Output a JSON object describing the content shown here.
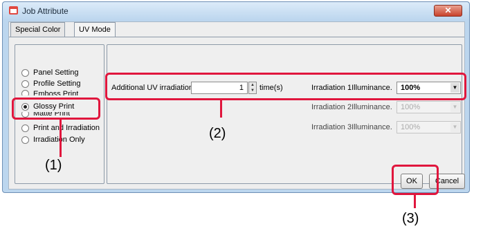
{
  "window": {
    "title": "Job Attribute",
    "close_label": "✕"
  },
  "tabs": [
    {
      "label": "Special Color",
      "active": false
    },
    {
      "label": "UV Mode",
      "active": true
    }
  ],
  "modes": [
    {
      "label": "Panel Setting",
      "checked": false
    },
    {
      "label": "Profile Setting",
      "checked": false
    },
    {
      "label": "Emboss Print",
      "checked": false
    },
    {
      "label": "Glossy Print",
      "checked": true
    },
    {
      "label": "Matte Print",
      "checked": false
    },
    {
      "label": "Print and Irradiation",
      "checked": false
    },
    {
      "label": "Irradiation Only",
      "checked": false
    }
  ],
  "uv": {
    "additional_label": "Additional UV irradiation",
    "additional_value": "1",
    "unit": "time(s)"
  },
  "illuminance": [
    {
      "label": "Irradiation 1Illuminance.",
      "value": "100%",
      "enabled": true
    },
    {
      "label": "Irradiation 2Illuminance.",
      "value": "100%",
      "enabled": false
    },
    {
      "label": "Irradiation 3Illuminance.",
      "value": "100%",
      "enabled": false
    }
  ],
  "buttons": {
    "ok": "OK",
    "cancel": "Cancel"
  },
  "callouts": [
    "(1)",
    "(2)",
    "(3)"
  ],
  "colors": {
    "highlight": "#e0163d",
    "titlebar": "#bcd6ee",
    "close": "#c8432c"
  }
}
